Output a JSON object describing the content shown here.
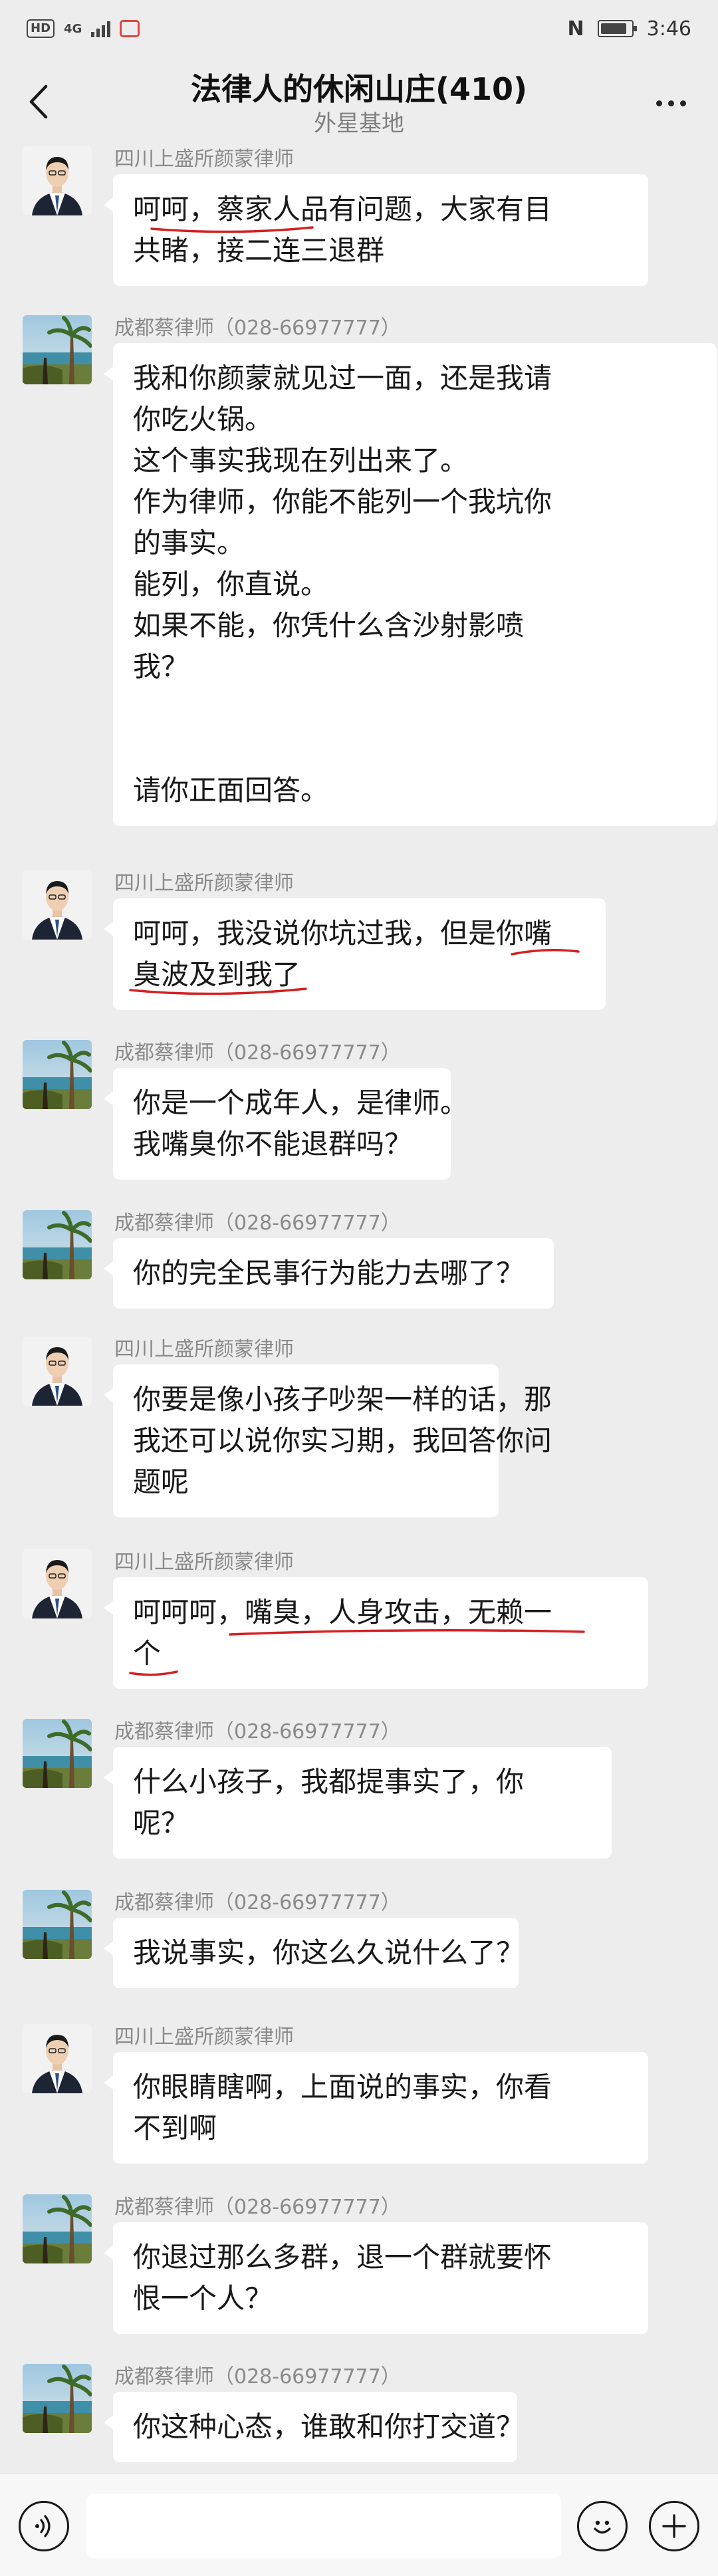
{
  "status_bar": {
    "hd": "HD",
    "network": "4G",
    "time": "3:46"
  },
  "header": {
    "title": "法律人的休闲山庄(410)",
    "subtitle": "外星基地"
  },
  "colors": {
    "background": "#ededed",
    "bubble": "#ffffff",
    "sender_name": "#8a8a8a",
    "annotation_red": "#d42020"
  },
  "icons": [
    "back-icon",
    "more-icon",
    "voice-icon",
    "emoji-icon",
    "plus-icon",
    "avatar-photo-man-in-suit",
    "avatar-photo-palm-beach"
  ],
  "messages": [
    {
      "sender": "四川上盛所颜蒙律师",
      "avatar": "suit",
      "lines": [
        "呵呵，蔡家人品有问题，大家有目",
        "共睹，接二连三退群"
      ]
    },
    {
      "sender": "成都蔡律师（028-66977777）",
      "avatar": "beach",
      "lines": [
        "我和你颜蒙就见过一面，还是我请",
        "你吃火锅。",
        "这个事实我现在列出来了。",
        "作为律师，你能不能列一个我坑你",
        "的事实。",
        "能列，你直说。",
        "如果不能，你凭什么含沙射影喷",
        "我？",
        "",
        "",
        "请你正面回答。"
      ]
    },
    {
      "sender": "四川上盛所颜蒙律师",
      "avatar": "suit",
      "lines": [
        "呵呵，我没说你坑过我，但是你嘴",
        "臭波及到我了"
      ]
    },
    {
      "sender": "成都蔡律师（028-66977777）",
      "avatar": "beach",
      "lines": [
        "你是一个成年人，是律师。",
        "我嘴臭你不能退群吗？"
      ]
    },
    {
      "sender": "成都蔡律师（028-66977777）",
      "avatar": "beach",
      "lines": [
        "你的完全民事行为能力去哪了？"
      ]
    },
    {
      "sender": "四川上盛所颜蒙律师",
      "avatar": "suit",
      "lines": [
        "你要是像小孩子吵架一样的话，那",
        "我还可以说你实习期，我回答你问",
        "题呢"
      ]
    },
    {
      "sender": "四川上盛所颜蒙律师",
      "avatar": "suit",
      "lines": [
        "呵呵呵，嘴臭，人身攻击，无赖一",
        "个"
      ]
    },
    {
      "sender": "成都蔡律师（028-66977777）",
      "avatar": "beach",
      "lines": [
        "什么小孩子，我都提事实了，你",
        "呢？"
      ]
    },
    {
      "sender": "成都蔡律师（028-66977777）",
      "avatar": "beach",
      "lines": [
        "我说事实，你这么久说什么了？"
      ]
    },
    {
      "sender": "四川上盛所颜蒙律师",
      "avatar": "suit",
      "lines": [
        "你眼睛瞎啊，上面说的事实，你看",
        "不到啊"
      ]
    },
    {
      "sender": "成都蔡律师（028-66977777）",
      "avatar": "beach",
      "lines": [
        "你退过那么多群，退一个群就要怀",
        "恨一个人？"
      ]
    },
    {
      "sender": "成都蔡律师（028-66977777）",
      "avatar": "beach",
      "lines": [
        "你这种心态，谁敢和你打交道？"
      ]
    }
  ]
}
